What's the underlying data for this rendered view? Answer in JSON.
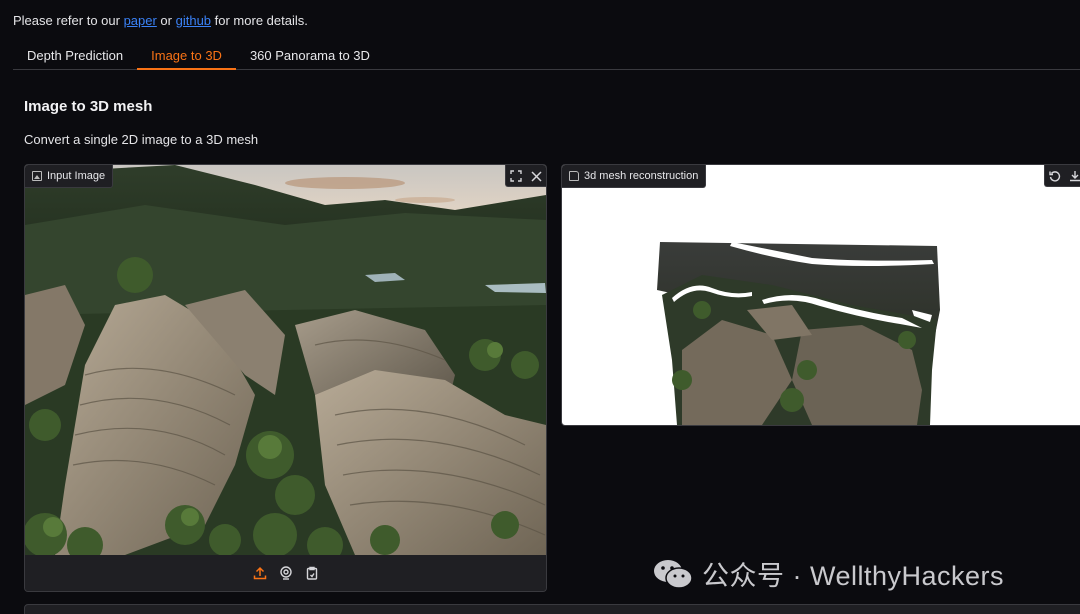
{
  "intro": {
    "prefix": "Please refer to our ",
    "link1": "paper",
    "middle": " or ",
    "link2": "github",
    "suffix": " for more details."
  },
  "tabs": [
    {
      "label": "Depth Prediction",
      "active": false
    },
    {
      "label": "Image to 3D",
      "active": true
    },
    {
      "label": "360 Panorama to 3D",
      "active": false
    }
  ],
  "section": {
    "title": "Image to 3D mesh",
    "description": "Convert a single 2D image to a 3D mesh"
  },
  "input_panel": {
    "label": "Input Image",
    "label_icon": "image-icon",
    "tools": [
      "fullscreen-icon",
      "close-icon"
    ],
    "footer_tools": [
      "upload-icon",
      "webcam-icon",
      "clipboard-icon"
    ]
  },
  "output_panel": {
    "label": "3d mesh reconstruction",
    "label_icon": "file-icon",
    "tools": [
      "reset-icon",
      "download-icon"
    ]
  },
  "watermark": {
    "text": "公众号 · WellthyHackers"
  },
  "colors": {
    "accent": "#f97316",
    "link": "#3b82f6",
    "background": "#0b0b0f",
    "panel": "#1f1f23"
  }
}
